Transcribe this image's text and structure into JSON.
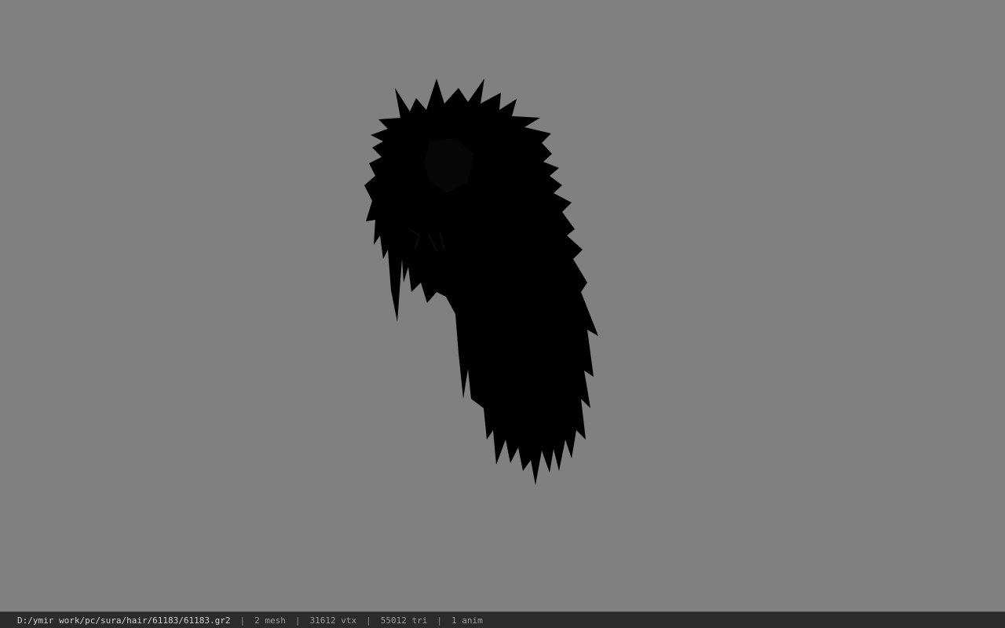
{
  "viewport": {
    "background_color": "#808080",
    "model_color": "#000000",
    "model": "hair-mesh"
  },
  "status": {
    "path": "D:/ymir work/pc/sura/hair/61183/61183.gr2",
    "separator": "|",
    "mesh": "2 mesh",
    "vtx": "31612 vtx",
    "tri": "55012 tri",
    "anim": "1 anim"
  }
}
